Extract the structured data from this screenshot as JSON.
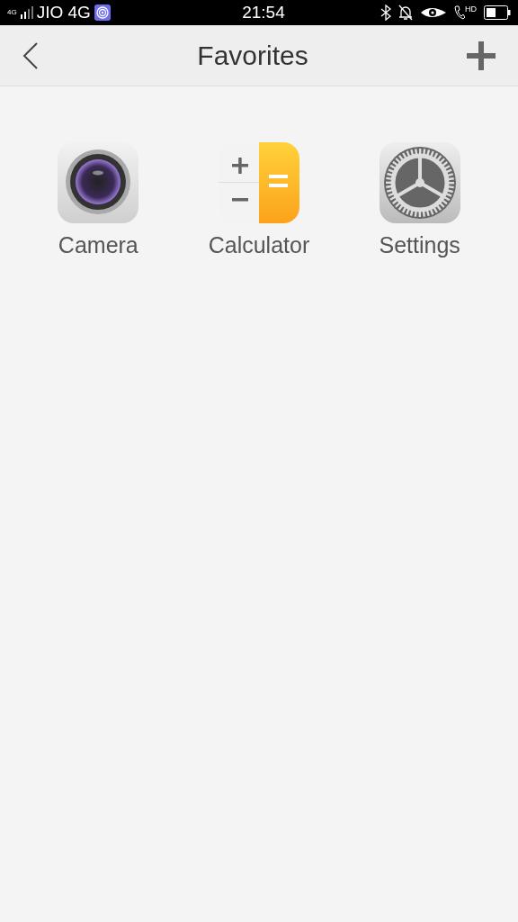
{
  "status_bar": {
    "network_badge": "4G",
    "carrier": "JIO 4G",
    "time": "21:54",
    "call_badge": "HD"
  },
  "header": {
    "title": "Favorites"
  },
  "apps": [
    {
      "kind": "camera",
      "label": "Camera"
    },
    {
      "kind": "calculator",
      "label": "Calculator"
    },
    {
      "kind": "settings",
      "label": "Settings"
    }
  ]
}
